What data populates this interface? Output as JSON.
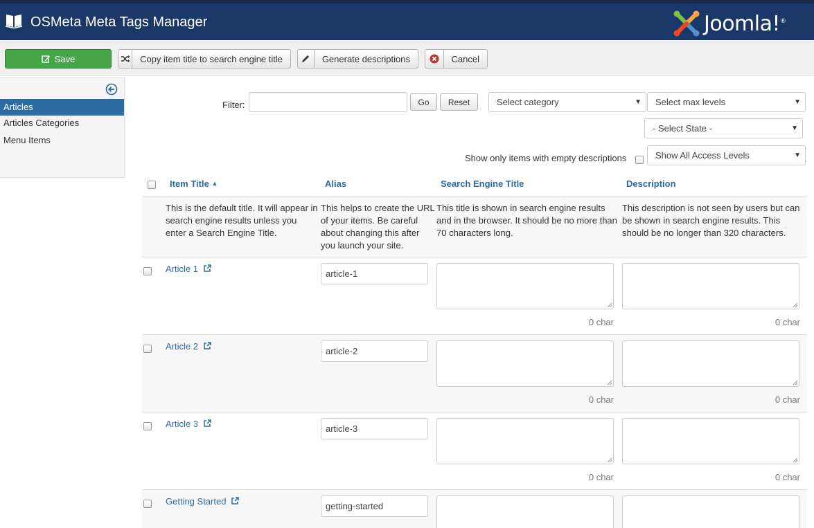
{
  "header": {
    "title": "OSMeta Meta Tags Manager",
    "brand": "Joomla!",
    "colors": {
      "header_bg": "#1a3867",
      "save_green": "#46a546",
      "link_blue": "#2d6ca2"
    }
  },
  "toolbar": {
    "save": {
      "label": "Save",
      "icon": "edit-icon"
    },
    "copy": {
      "label": "Copy item title to search engine title",
      "icon": "shuffle-icon"
    },
    "generate": {
      "label": "Generate descriptions",
      "icon": "pencil-icon"
    },
    "cancel": {
      "label": "Cancel",
      "icon": "cancel-circle-icon"
    }
  },
  "sidebar": {
    "toggle_icon": "collapse-left-icon",
    "items": [
      {
        "label": "Articles",
        "active": true
      },
      {
        "label": "Articles Categories",
        "active": false
      },
      {
        "label": "Menu Items",
        "active": false
      }
    ]
  },
  "filters": {
    "filter_label": "Filter:",
    "filter_value": "",
    "go_label": "Go",
    "reset_label": "Reset",
    "category": "Select category",
    "max_levels": "Select max levels",
    "state": "- Select State -",
    "access": "Show All Access Levels",
    "empty_only_label": "Show only items with empty descriptions"
  },
  "table": {
    "columns": {
      "title": "Item Title",
      "alias": "Alias",
      "se_title": "Search Engine Title",
      "description": "Description"
    },
    "help": {
      "title": "This is the default title. It will appear in search engine results unless you enter a Search Engine Title.",
      "alias": "This helps to create the URL of your items. Be careful about changing this after you launch your site.",
      "se_title": "This title is shown in search engine results and in the browser. It should be no more than 70 characters long.",
      "description": "This description is not seen by users but can be shown in search engine results. This should be no longer than 320 characters."
    },
    "rows": [
      {
        "title": "Article 1",
        "alias": "article-1",
        "se_title_count": "0 char",
        "desc_count": "0 char"
      },
      {
        "title": "Article 2",
        "alias": "article-2",
        "se_title_count": "0 char",
        "desc_count": "0 char"
      },
      {
        "title": "Article 3",
        "alias": "article-3",
        "se_title_count": "0 char",
        "desc_count": "0 char"
      },
      {
        "title": "Getting Started",
        "alias": "getting-started",
        "se_title_count": "",
        "desc_count": ""
      }
    ]
  }
}
